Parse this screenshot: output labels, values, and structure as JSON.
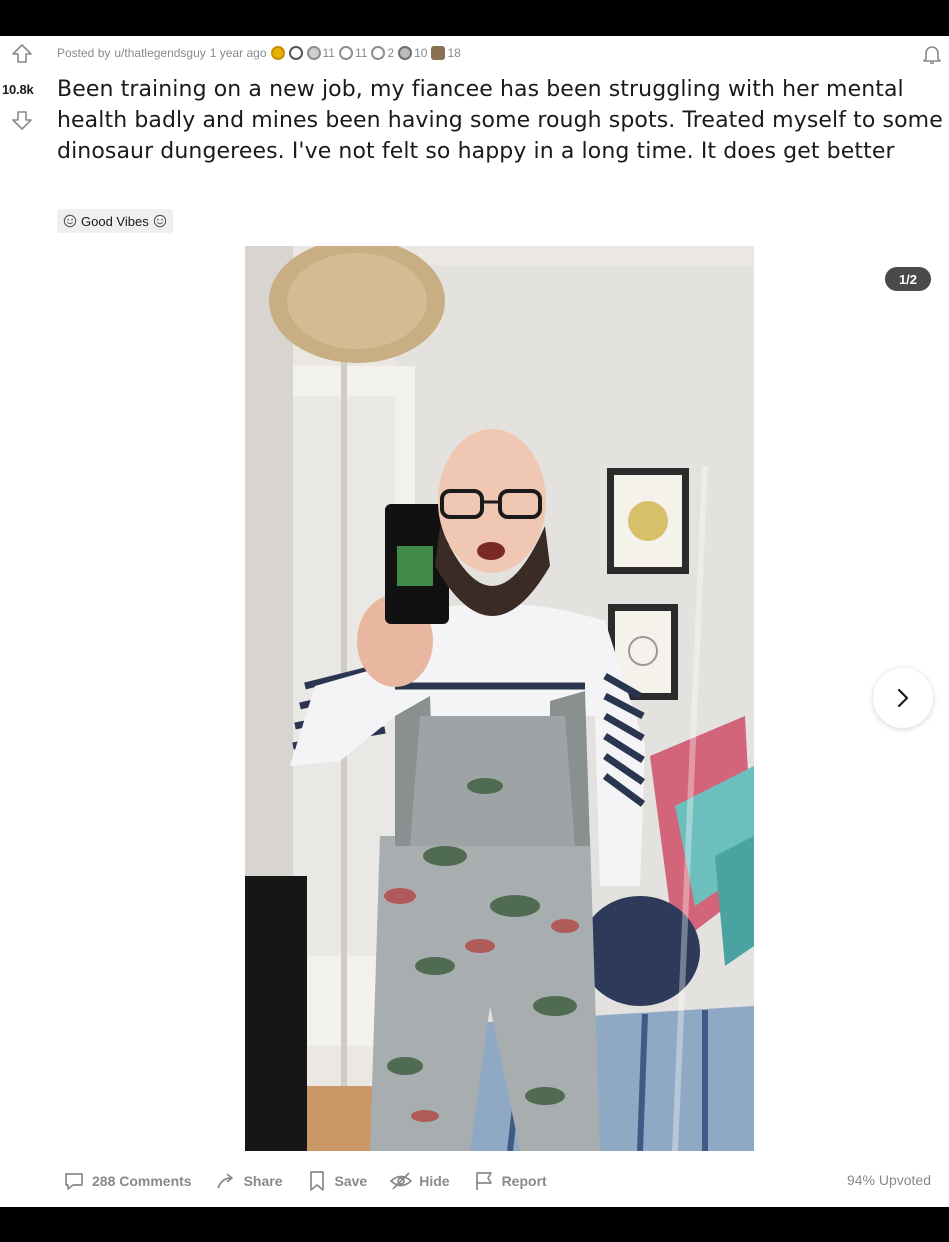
{
  "post": {
    "score": "10.8k",
    "posted_by_prefix": "Posted by",
    "author": "u/thatlegendsguy",
    "age": "1 year ago",
    "awards": [
      {
        "icon": "gold-award-icon",
        "color": "#e8b100",
        "count": ""
      },
      {
        "icon": "wholesome-award-icon",
        "color": "#7a7a7a",
        "count": ""
      },
      {
        "icon": "helpful-award-icon",
        "color": "#8e8e8e",
        "count": "11"
      },
      {
        "icon": "hug-award-icon",
        "color": "#8e8e8e",
        "count": "11"
      },
      {
        "icon": "heartwarming-award-icon",
        "color": "#8e8e8e",
        "count": "2"
      },
      {
        "icon": "silver-award-icon",
        "color": "#8e8e8e",
        "count": "10"
      },
      {
        "icon": "bear-award-icon",
        "color": "#6b5a48",
        "count": "18"
      }
    ],
    "title": "Been training on a new job, my fiancee has been struggling with her mental health badly and mines been having some rough spots. Treated myself to some dinosaur dungerees. I've not felt so happy in a long time. It does get better",
    "flair": "Good Vibes",
    "gallery_counter": "1/2",
    "image_alt": "man in dinosaur dungarees mirror selfie"
  },
  "actions": {
    "comments": "288 Comments",
    "share": "Share",
    "save": "Save",
    "hide": "Hide",
    "report": "Report",
    "upvoted": "94% Upvoted"
  },
  "colors": {
    "meta_text": "#878a8c",
    "title_text": "#1a1a1b",
    "counter_bg": "#4a4a4c"
  }
}
